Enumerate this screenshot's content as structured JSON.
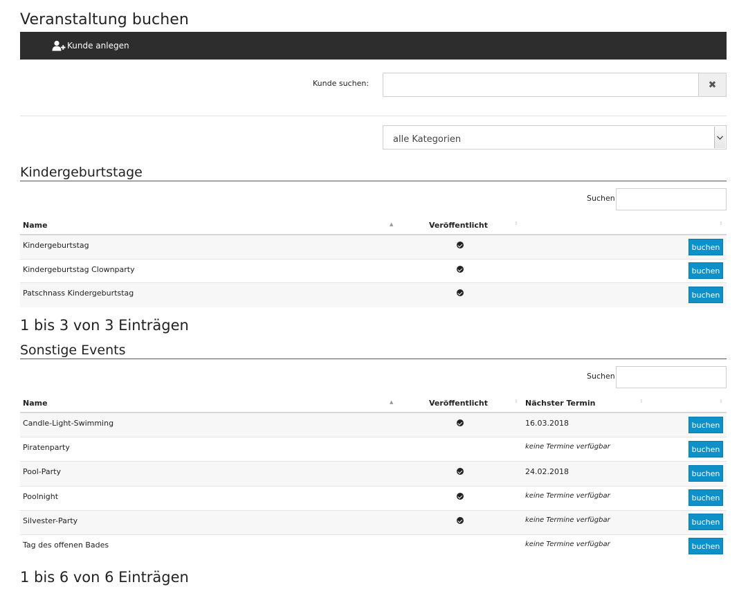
{
  "page": {
    "title": "Veranstaltung buchen"
  },
  "toolbar": {
    "new_customer_label": "Kunde anlegen",
    "new_customer_icon": "user-plus-icon",
    "background": "#2d2d2d"
  },
  "customer_search": {
    "label": "Kunde suchen:",
    "value": "",
    "clear_icon": "close-icon"
  },
  "category_filter": {
    "selected": "alle Kategorien"
  },
  "accent_color": "#0e90c8",
  "sections": [
    {
      "title": "Kindergeburtstage",
      "search_label": "Suchen",
      "columns": {
        "name": "Name",
        "published": "Veröffentlicht"
      },
      "rows": [
        {
          "name": "Kindergeburtstag",
          "published": true,
          "action": "buchen"
        },
        {
          "name": "Kindergeburtstag Clownparty",
          "published": true,
          "action": "buchen"
        },
        {
          "name": "Patschnass Kindergeburtstag",
          "published": true,
          "action": "buchen"
        }
      ],
      "info": "1 bis 3 von 3 Einträgen"
    },
    {
      "title": "Sonstige Events",
      "search_label": "Suchen",
      "columns": {
        "name": "Name",
        "published": "Veröffentlicht",
        "next_date": "Nächster Termin"
      },
      "rows": [
        {
          "name": "Candle-Light-Swimming",
          "published": true,
          "next_date": "16.03.2018",
          "action": "buchen"
        },
        {
          "name": "Piratenparty",
          "published": false,
          "next_date": "keine Termine verfügbar",
          "action": "buchen"
        },
        {
          "name": "Pool-Party",
          "published": true,
          "next_date": "24.02.2018",
          "action": "buchen"
        },
        {
          "name": "Poolnight",
          "published": true,
          "next_date": "keine Termine verfügbar",
          "action": "buchen"
        },
        {
          "name": "Silvester-Party",
          "published": true,
          "next_date": "keine Termine verfügbar",
          "action": "buchen"
        },
        {
          "name": "Tag des offenen Bades",
          "published": false,
          "next_date": "keine Termine verfügbar",
          "action": "buchen"
        }
      ],
      "info": "1 bis 6 von 6 Einträgen"
    }
  ]
}
